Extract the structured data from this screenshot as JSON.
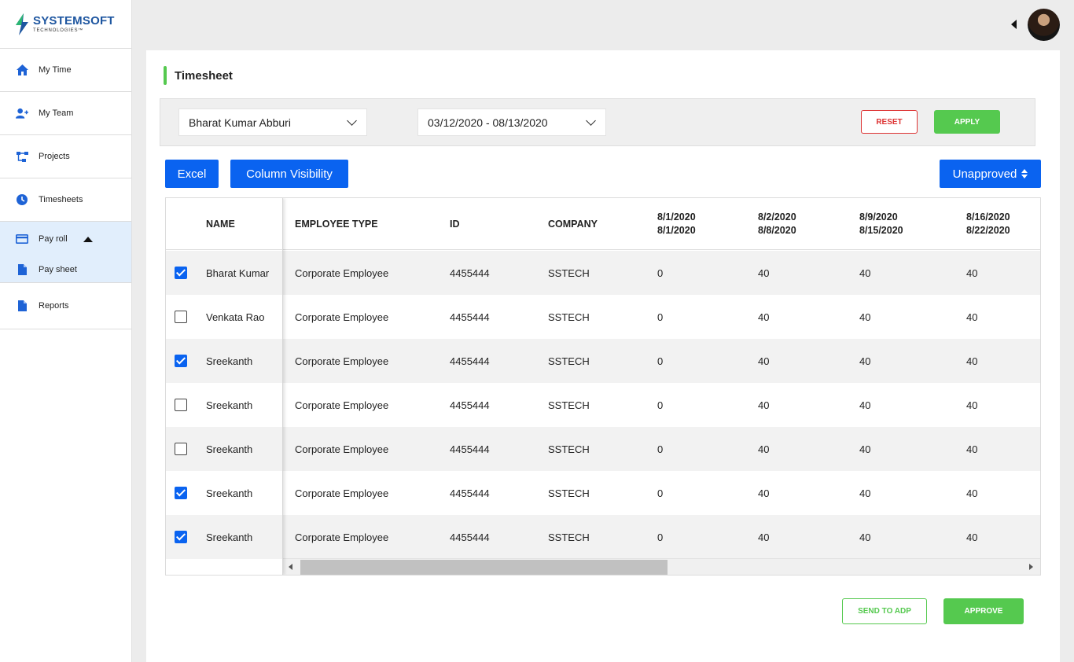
{
  "brand": {
    "name": "SYSTEMSOFT",
    "tagline": "TECHNOLOGIES™",
    "color": "#1e56a0"
  },
  "sidebar": {
    "items": [
      {
        "label": "My Time",
        "icon": "home-icon"
      },
      {
        "label": "My Team",
        "icon": "add-user-icon"
      },
      {
        "label": "Projects",
        "icon": "hierarchy-icon"
      },
      {
        "label": "Timesheets",
        "icon": "clock-icon"
      },
      {
        "label": "Pay roll",
        "icon": "credit-card-icon",
        "expanded": true
      },
      {
        "label": "Pay sheet",
        "icon": "document-icon"
      },
      {
        "label": "Reports",
        "icon": "document-icon"
      }
    ]
  },
  "page": {
    "title": "Timesheet"
  },
  "filters": {
    "employee": "Bharat Kumar Abburi",
    "date_range": "03/12/2020 - 08/13/2020",
    "reset_label": "RESET",
    "apply_label": "APPLY"
  },
  "toolbar": {
    "excel_label": "Excel",
    "column_visibility_label": "Column Visibility",
    "status_filter": "Unapproved"
  },
  "table": {
    "headers": {
      "name": "NAME",
      "employee_type": "EMPLOYEE TYPE",
      "id": "ID",
      "company": "COMPANY",
      "week1_a": "8/1/2020",
      "week1_b": "8/1/2020",
      "week2_a": "8/2/2020",
      "week2_b": "8/8/2020",
      "week3_a": "8/9/2020",
      "week3_b": "8/15/2020",
      "week4_a": "8/16/2020",
      "week4_b": "8/22/2020"
    },
    "rows": [
      {
        "checked": true,
        "name": "Bharat Kumar",
        "type": "Corporate Employee",
        "id": "4455444",
        "company": "SSTECH",
        "w1": "0",
        "w2": "40",
        "w3": "40",
        "w4": "40"
      },
      {
        "checked": false,
        "name": "Venkata Rao",
        "type": "Corporate Employee",
        "id": "4455444",
        "company": "SSTECH",
        "w1": "0",
        "w2": "40",
        "w3": "40",
        "w4": "40"
      },
      {
        "checked": true,
        "name": "Sreekanth",
        "type": "Corporate Employee",
        "id": "4455444",
        "company": "SSTECH",
        "w1": "0",
        "w2": "40",
        "w3": "40",
        "w4": "40"
      },
      {
        "checked": false,
        "name": "Sreekanth",
        "type": "Corporate Employee",
        "id": "4455444",
        "company": "SSTECH",
        "w1": "0",
        "w2": "40",
        "w3": "40",
        "w4": "40"
      },
      {
        "checked": false,
        "name": "Sreekanth",
        "type": "Corporate Employee",
        "id": "4455444",
        "company": "SSTECH",
        "w1": "0",
        "w2": "40",
        "w3": "40",
        "w4": "40"
      },
      {
        "checked": true,
        "name": "Sreekanth",
        "type": "Corporate Employee",
        "id": "4455444",
        "company": "SSTECH",
        "w1": "0",
        "w2": "40",
        "w3": "40",
        "w4": "40"
      },
      {
        "checked": true,
        "name": "Sreekanth",
        "type": "Corporate Employee",
        "id": "4455444",
        "company": "SSTECH",
        "w1": "0",
        "w2": "40",
        "w3": "40",
        "w4": "40"
      }
    ]
  },
  "actions": {
    "send_label": "SEND TO ADP",
    "approve_label": "APPROVE"
  },
  "colors": {
    "primary": "#0a63f0",
    "success": "#55c94f",
    "danger": "#dd3333"
  }
}
